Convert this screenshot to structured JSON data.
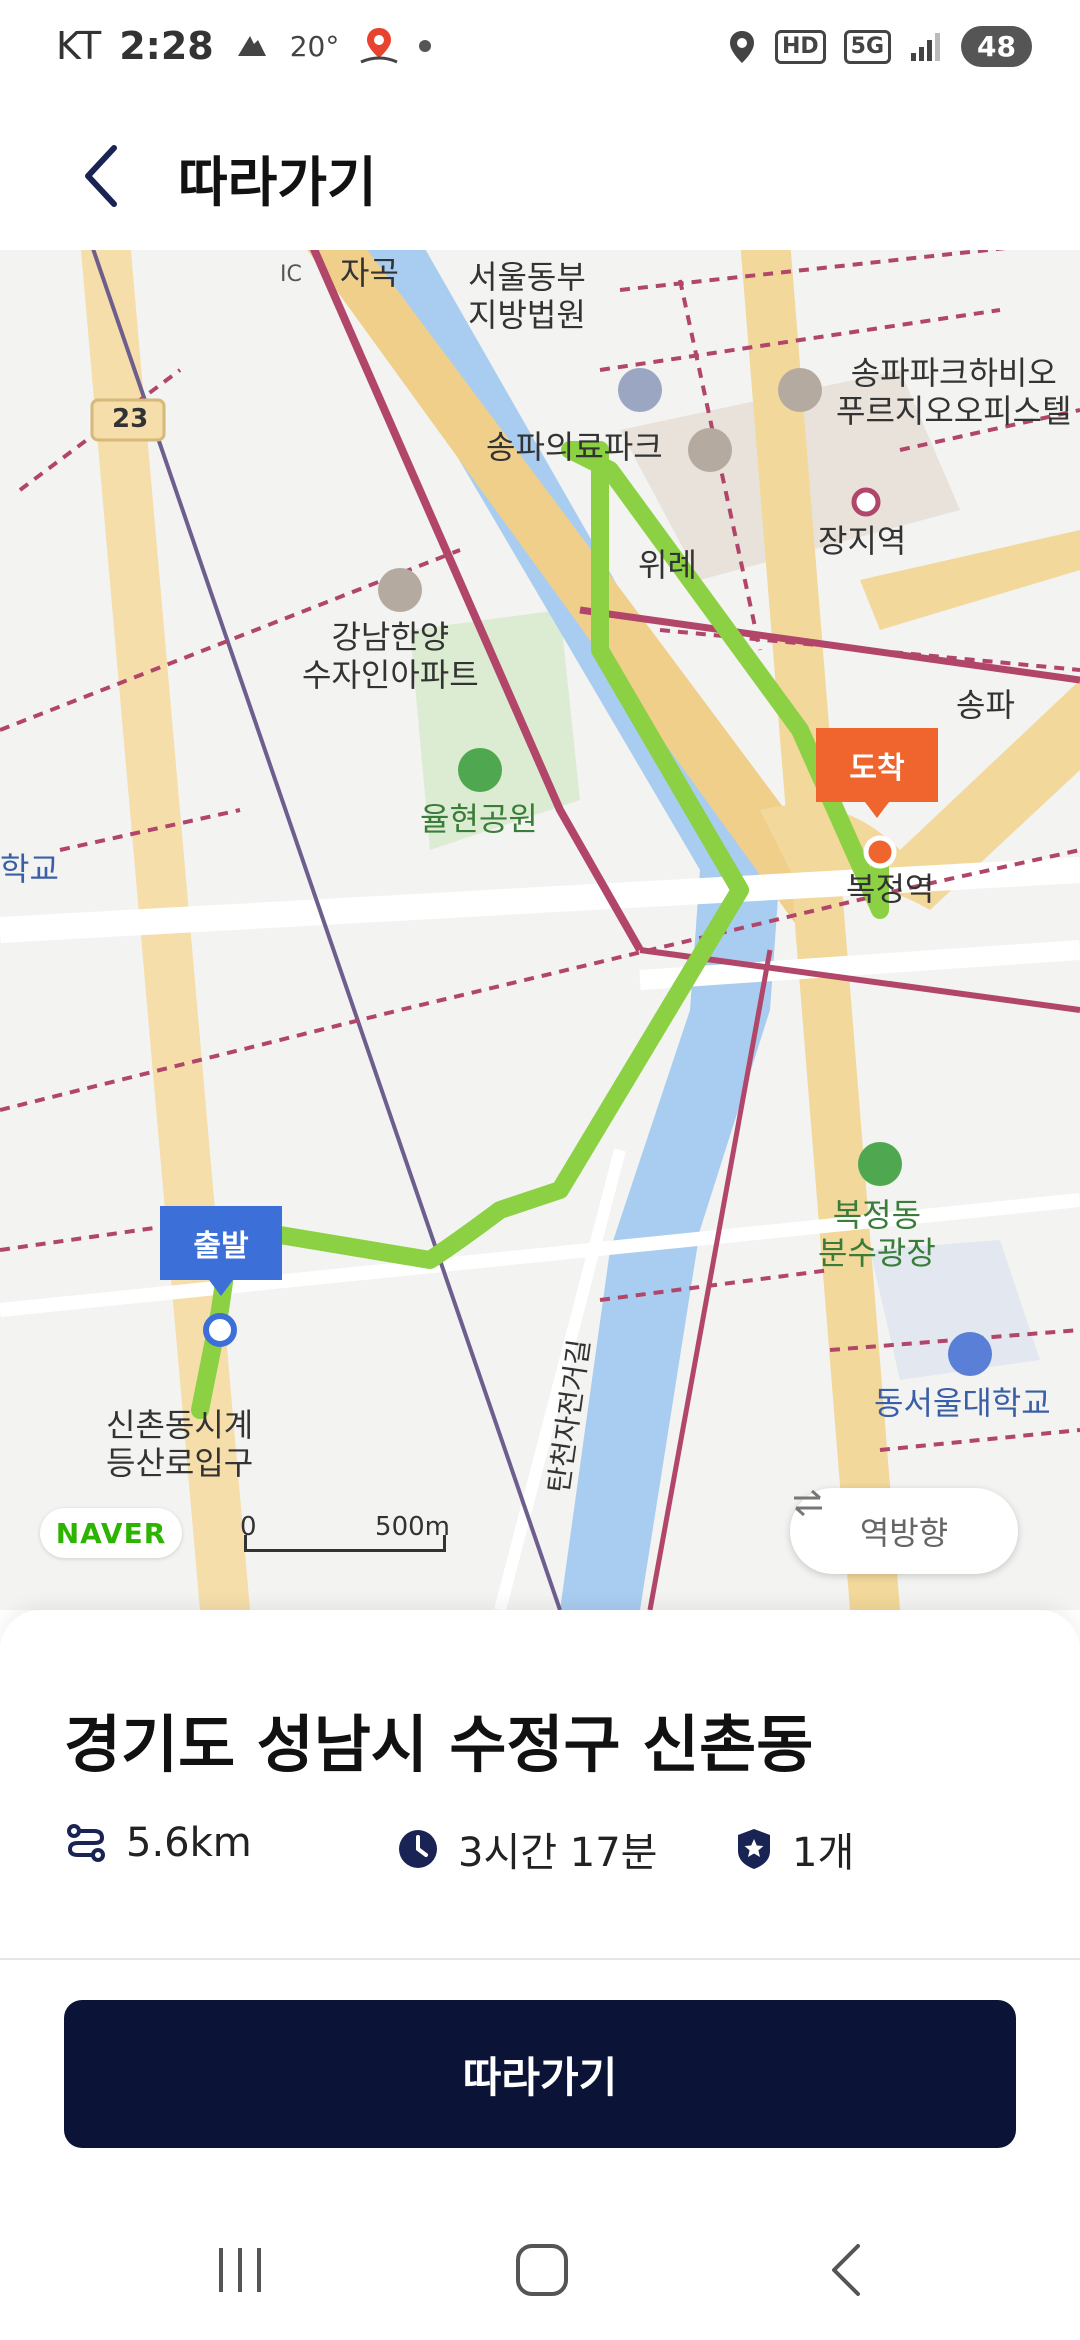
{
  "status_bar": {
    "carrier": "KT",
    "time": "2:28",
    "temperature": "20°",
    "network": "5G",
    "hd": "HD",
    "battery": "48"
  },
  "header": {
    "title": "따라가기",
    "back_icon": "chevron-left-icon"
  },
  "map": {
    "labels": {
      "court": "서울동부\n지방법원",
      "songpa_hive": "송파파크하비오\n푸르지오오피스텔",
      "jangji_station": "장지역",
      "songpa_park": "송파의료파크",
      "wirye": "위례",
      "gangnam_hanyang": "강남한양\n수자인아파트",
      "yulhyeon_park": "율현공원",
      "school_left": "학교",
      "songpa_ic": "송파",
      "bokjeong_station": "복정역",
      "bokjeong_fountain": "복정동\n분수광장",
      "east_seoul_univ": "동서울대학교",
      "trailhead": "신촌동시계\n등산로입구",
      "bike_road": "탄천자전거길",
      "road_23": "23",
      "jagok": "자곡",
      "ic": "IC"
    },
    "start_marker": "출발",
    "end_marker": "도착",
    "brand": "NAVER",
    "scale": {
      "zero": "0",
      "max": "500m"
    },
    "reverse_button": "역방향",
    "colors": {
      "route": "#8bd143",
      "water": "#a9cdf0",
      "main_road": "#f2d89a",
      "rail": "#b1466a"
    }
  },
  "route": {
    "location": "경기도 성남시 수정구 신촌동",
    "distance": "5.6km",
    "duration": "3시간 17분",
    "badges": "1개",
    "follow_button": "따라가기"
  },
  "nav": {
    "recent": "recent-apps-icon",
    "home": "home-icon",
    "back": "back-icon"
  }
}
